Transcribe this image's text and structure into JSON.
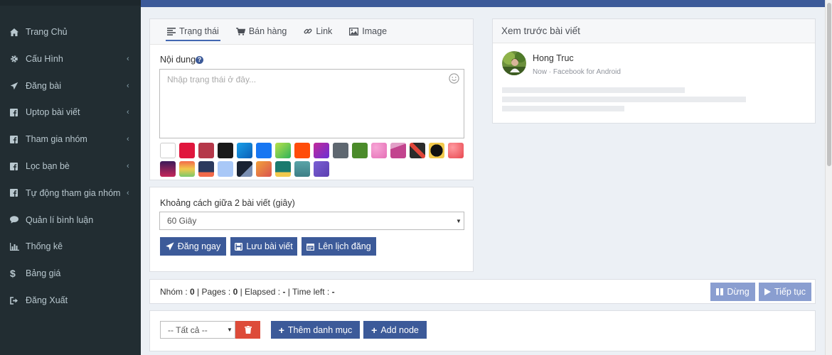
{
  "sidebar": {
    "items": [
      {
        "label": "Trang Chủ",
        "icon": "home-icon",
        "chevron": false
      },
      {
        "label": "Cấu Hình",
        "icon": "gear-icon",
        "chevron": true
      },
      {
        "label": "Đăng bài",
        "icon": "paper-plane-icon",
        "chevron": true
      },
      {
        "label": "Uptop bài viết",
        "icon": "facebook-square-icon",
        "chevron": true
      },
      {
        "label": "Tham gia nhóm",
        "icon": "facebook-square-icon",
        "chevron": true
      },
      {
        "label": "Lọc bạn bè",
        "icon": "facebook-square-icon",
        "chevron": true
      },
      {
        "label": "Tự động tham gia nhóm",
        "icon": "facebook-square-icon",
        "chevron": true
      },
      {
        "label": "Quản lí bình luận",
        "icon": "comment-icon",
        "chevron": false
      },
      {
        "label": "Thống kê",
        "icon": "bar-chart-icon",
        "chevron": false
      },
      {
        "label": "Bảng giá",
        "icon": "dollar-icon",
        "chevron": false
      },
      {
        "label": "Đăng Xuất",
        "icon": "sign-out-icon",
        "chevron": false
      }
    ],
    "chevron_glyph": "‹"
  },
  "composer": {
    "tabs": [
      {
        "label": "Trạng thái",
        "icon": "align-left-icon",
        "active": true
      },
      {
        "label": "Bán hàng",
        "icon": "cart-icon",
        "active": false
      },
      {
        "label": "Link",
        "icon": "link-icon",
        "active": false
      },
      {
        "label": "Image",
        "icon": "image-icon",
        "active": false
      }
    ],
    "content_label": "Nội dung",
    "help_glyph": "?",
    "placeholder": "Nhập trạng thái ở đây...",
    "value": "",
    "backgrounds": [
      "#ffffff",
      "#e0163d",
      "#b5384a",
      "#1a1a1a",
      "#1aa0e8",
      "#1877f2",
      "#8bd43a",
      "#ff4d0a",
      "#8b2fc9",
      "#5e6770",
      "#4b8b2a",
      "#e56fb6",
      "#c2448e",
      "#2b2b2b",
      "#111111",
      "#e8474f",
      "#7a1a3c",
      "#f2a33a",
      "#2c3a5e",
      "#a9c8f7",
      "#1a2333",
      "#e8694a",
      "#1b7a6e",
      "#5aa4a8",
      "#6b4fbf"
    ]
  },
  "settings": {
    "interval_label": "Khoảng cách giữa 2 bài viết (giây)",
    "interval_value": "60 Giây",
    "buttons": {
      "post_now": "Đăng ngay",
      "save_post": "Lưu bài viết",
      "schedule": "Lên lịch đăng"
    }
  },
  "preview": {
    "title": "Xem trước bài viết",
    "author": "Hong Truc",
    "meta": "Now · Facebook for Android"
  },
  "progress": {
    "groups_label": "Nhóm",
    "groups_value": "0",
    "pages_label": "Pages",
    "pages_value": "0",
    "elapsed_label": "Elapsed",
    "elapsed_value": "-",
    "left_label": "Time left",
    "left_value": "-",
    "stop_label": "Dừng",
    "continue_label": "Tiếp tục"
  },
  "category": {
    "filter_value": "-- Tất cả --",
    "add_category_label": "Thêm danh mục",
    "add_node_label": "Add node"
  },
  "colors": {
    "sidebar_bg": "#222d32",
    "brand_blue": "#3c5a99",
    "danger": "#dd4b39"
  }
}
